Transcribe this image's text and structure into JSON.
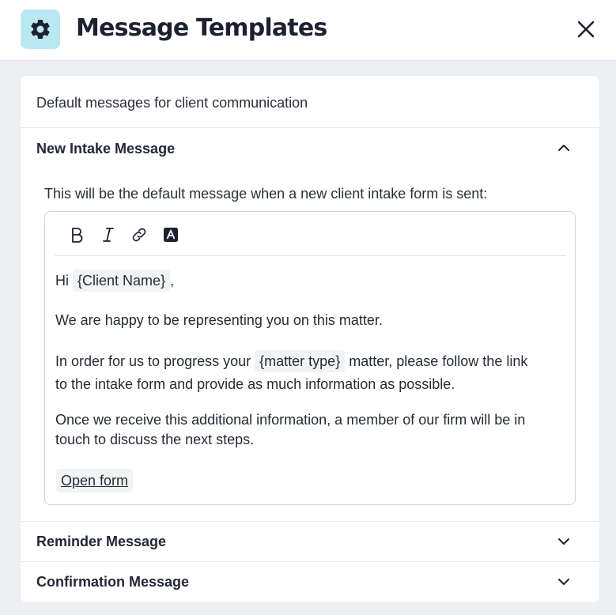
{
  "header": {
    "title": "Message Templates",
    "icon": "gear-icon",
    "accent_color": "#b9e8f0"
  },
  "card": {
    "description": "Default messages for client communication"
  },
  "sections": [
    {
      "title": "New Intake Message",
      "expanded": true
    },
    {
      "title": "Reminder Message",
      "expanded": false
    },
    {
      "title": "Confirmation Message",
      "expanded": false
    }
  ],
  "editor": {
    "intro": "This will be the default message when a new client intake form is sent:",
    "toolbar": [
      "bold-icon",
      "italic-icon",
      "link-icon",
      "text-color-icon"
    ],
    "greeting_prefix": "Hi",
    "client_name_chip": "{Client Name}",
    "greeting_suffix": ",",
    "para1": "We are happy to be representing you on this matter.",
    "para2_prefix": "In order for us to progress your",
    "matter_type_chip": "{matter type}",
    "para2_suffix": "matter, please follow the link",
    "para2_line2": "to the intake form and provide as much information as possible.",
    "para3_line1": "Once we receive this additional information, a member of our firm will be in",
    "para3_line2": "touch to discuss the next steps.",
    "link_label": "Open form"
  }
}
